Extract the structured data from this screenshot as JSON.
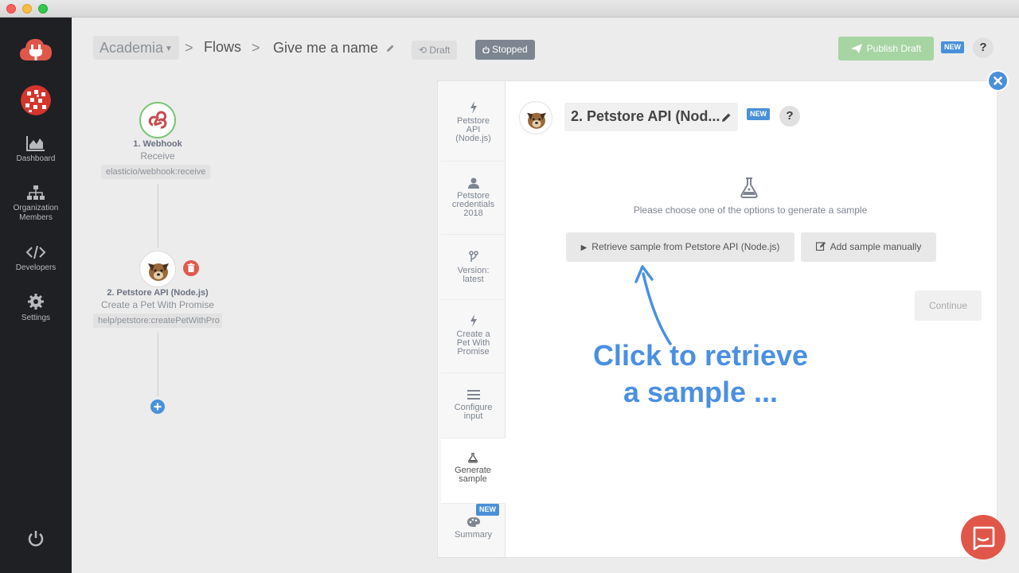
{
  "window": {
    "controls": [
      "close",
      "minimize",
      "zoom"
    ]
  },
  "sidebar": {
    "items": [
      {
        "label": "Dashboard",
        "icon": "chart-area-icon"
      },
      {
        "label": "Organization Members",
        "icon": "org-chart-icon"
      },
      {
        "label": "Developers",
        "icon": "code-icon"
      },
      {
        "label": "Settings",
        "icon": "gear-icon"
      }
    ],
    "logo": "cloud-plug-icon",
    "power": "power-icon"
  },
  "header": {
    "workspace": "Academia",
    "flows_label": "Flows",
    "flow_name": "Give me a name",
    "draft_label": "Draft",
    "stopped_label": "Stopped",
    "publish_label": "Publish Draft",
    "new_label": "NEW",
    "help_label": "?"
  },
  "flow": {
    "nodes": [
      {
        "title": "1. Webhook",
        "subtitle": "Receive",
        "chip": "elasticio/webhook:receive"
      },
      {
        "title": "2. Petstore API (Node.js)",
        "subtitle": "Create a Pet With Promise",
        "chip": "help/petstore:createPetWithPro"
      }
    ]
  },
  "panel": {
    "steps": [
      {
        "label": "Petstore API (Node.js)",
        "lines": [
          "Petstore",
          "API",
          "(Node.js)"
        ],
        "icon": "bolt-icon"
      },
      {
        "label": "Petstore credentials 2018",
        "lines": [
          "Petstore",
          "credentials",
          "2018"
        ],
        "icon": "user-icon"
      },
      {
        "label": "Version: latest",
        "lines": [
          "Version:",
          "latest"
        ],
        "icon": "branch-icon"
      },
      {
        "label": "Create a Pet With Promise",
        "lines": [
          "Create a",
          "Pet With",
          "Promise"
        ],
        "icon": "bolt-icon"
      },
      {
        "label": "Configure input",
        "lines": [
          "Configure",
          "input"
        ],
        "icon": "list-icon"
      },
      {
        "label": "Generate sample",
        "lines": [
          "Generate",
          "sample"
        ],
        "icon": "flask-icon"
      },
      {
        "label": "Summary",
        "lines": [
          "Summary"
        ],
        "icon": "palette-icon",
        "badge": "NEW"
      }
    ],
    "step_title": "2. Petstore API (Nod...",
    "new_label": "NEW",
    "help_label": "?",
    "hint": "Please choose one of the options to generate a sample",
    "retrieve_label": "Retrieve sample from Petstore API (Node.js)",
    "manual_label": "Add sample manually",
    "continue_label": "Continue"
  },
  "annotation": {
    "line1": "Click to retrieve",
    "line2": "a sample ..."
  },
  "colors": {
    "accent": "#4a90d9",
    "success": "#a7d4a3",
    "danger": "#e05a4f",
    "sidebar": "#1f2024",
    "callout": "#4a90e2"
  }
}
